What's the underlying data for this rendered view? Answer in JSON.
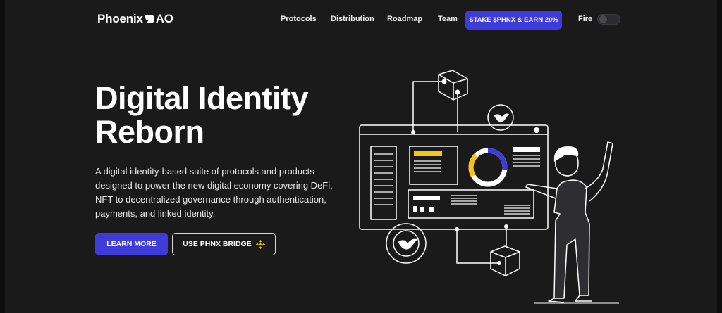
{
  "brand": {
    "name_start": "Phoenix",
    "name_end": "AO"
  },
  "nav": {
    "links": [
      "Protocols",
      "Distribution",
      "Roadmap",
      "Team"
    ],
    "stake_label": "STAKE $PHNX & EARN 20%",
    "theme_label": "Fire"
  },
  "hero": {
    "title_line1": "Digital Identity",
    "title_line2": "Reborn",
    "description": "A digital identity-based suite of protocols and products designed to power the new digital economy covering DeFi, NFT to decentralized governance through authentication, payments, and linked identity.",
    "learn_more_label": "LEARN MORE",
    "bridge_label": "USE PHNX BRIDGE"
  },
  "colors": {
    "accent": "#3f3bd9",
    "yellow": "#f5c518",
    "background": "#1b1a1b"
  },
  "icons": {
    "bridge": "binance-icon",
    "illustration_badge": "phoenix-bird-icon"
  }
}
